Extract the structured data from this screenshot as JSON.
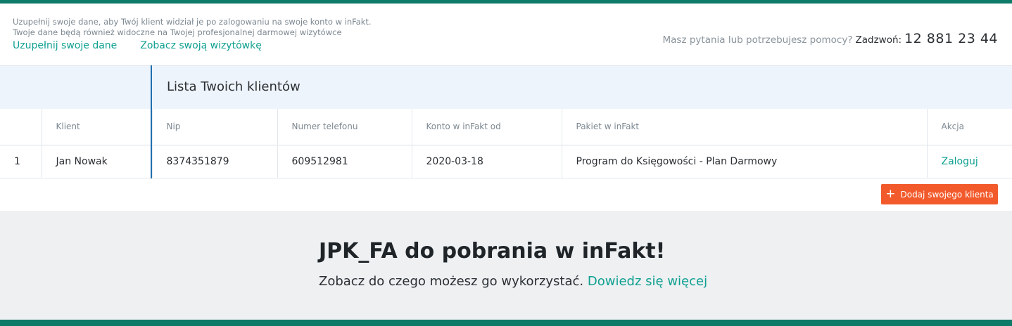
{
  "info": {
    "line1": "Uzupełnij swoje dane, aby Twój klient widział je po zalogowaniu na swoje konto w inFakt.",
    "line2": "Twoje dane będą również widoczne na Twojej profesjonalnej darmowej wizytówce",
    "link_fill": "Uzupełnij swoje dane",
    "link_card": "Zobacz swoją wizytówkę"
  },
  "help": {
    "question": "Masz pytania lub potrzebujesz pomocy?",
    "call_label": "Zadzwoń:",
    "phone": "12 881 23 44"
  },
  "clients": {
    "title": "Lista Twoich klientów",
    "columns": [
      "",
      "Klient",
      "Nip",
      "Numer telefonu",
      "Konto w inFakt od",
      "Pakiet w inFakt",
      "Akcja"
    ],
    "rows": [
      {
        "no": "1",
        "client": "Jan Nowak",
        "nip": "8374351879",
        "phone": "609512981",
        "since": "2020-03-18",
        "package": "Program do Księgowości - Plan Darmowy",
        "action": "Zaloguj"
      }
    ],
    "add_button": "Dodaj swojego klienta"
  },
  "promo": {
    "title": "JPK_FA do pobrania w inFakt!",
    "text": "Zobacz do czego możesz go wykorzystać.",
    "link": "Dowiedz się więcej"
  },
  "colors": {
    "brand_green": "#0e7a68",
    "link_teal": "#0fa091",
    "accent_orange": "#f25a2b",
    "table_accent_blue": "#1f6fb0"
  },
  "icons": {
    "add": "plus-icon"
  }
}
